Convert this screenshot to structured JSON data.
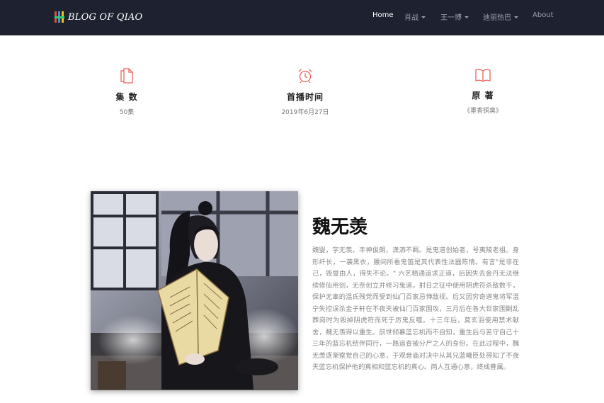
{
  "brand": {
    "text": "BLOG OF QIAO"
  },
  "nav": {
    "items": [
      {
        "label": "Home",
        "active": true,
        "dropdown": false
      },
      {
        "label": "肖战",
        "active": false,
        "dropdown": true
      },
      {
        "label": "王一博",
        "active": false,
        "dropdown": true
      },
      {
        "label": "迪丽热巴",
        "active": false,
        "dropdown": true
      },
      {
        "label": "About",
        "active": false,
        "dropdown": false
      }
    ]
  },
  "features": [
    {
      "icon": "document-icon",
      "title": "集 数",
      "value": "50集"
    },
    {
      "icon": "alarm-clock-icon",
      "title": "首播时间",
      "value": "2019年6月27日"
    },
    {
      "icon": "book-icon",
      "title": "原 著",
      "value": "《墨香铜臭》"
    }
  ],
  "character": {
    "name": "魏无羡",
    "description": "魏婴，字无羡。丰神俊朗，潇洒不羁。是鬼道创始者，号夷陵老祖。身形纤长，一袭黑衣，腰间所看鬼笛是其代表性法器陈情。有言\"是非在己，毁誉由人，得失不论。\" 六艺精通追求正道，后因失去金丹无法继续修仙用剑，无奈创立并修习鬼道。射日之征中使用阴虎符杀敌数千，保护无辜的温氏残党而受到仙门百家忌惮敌视。后又因穷奇道鬼将军温宁失控误杀金子轩在不夜天被仙门百家围攻，三月后在各大世家围剿乱葬岗时为毁掉阴虎符而死于厉鬼反噬。十三年后，莫玄羽使用禁术献舍，魏无羡得以重生。前世倾慕蓝忘机而不自知，重生后与苦守自己十三年的蓝忘机结伴同行，一路追查被分尸之人的身份。在此过程中，魏无羡逐渐察觉自己的心意，于观音庙对决中从其兄蓝曦臣处得知了不夜天蓝忘机保护他的真相和蓝忘机的真心。两人互通心意，终成眷属。"
  },
  "colors": {
    "navbar_bg": "#1e2130",
    "icon_accent": "#f0605a"
  }
}
